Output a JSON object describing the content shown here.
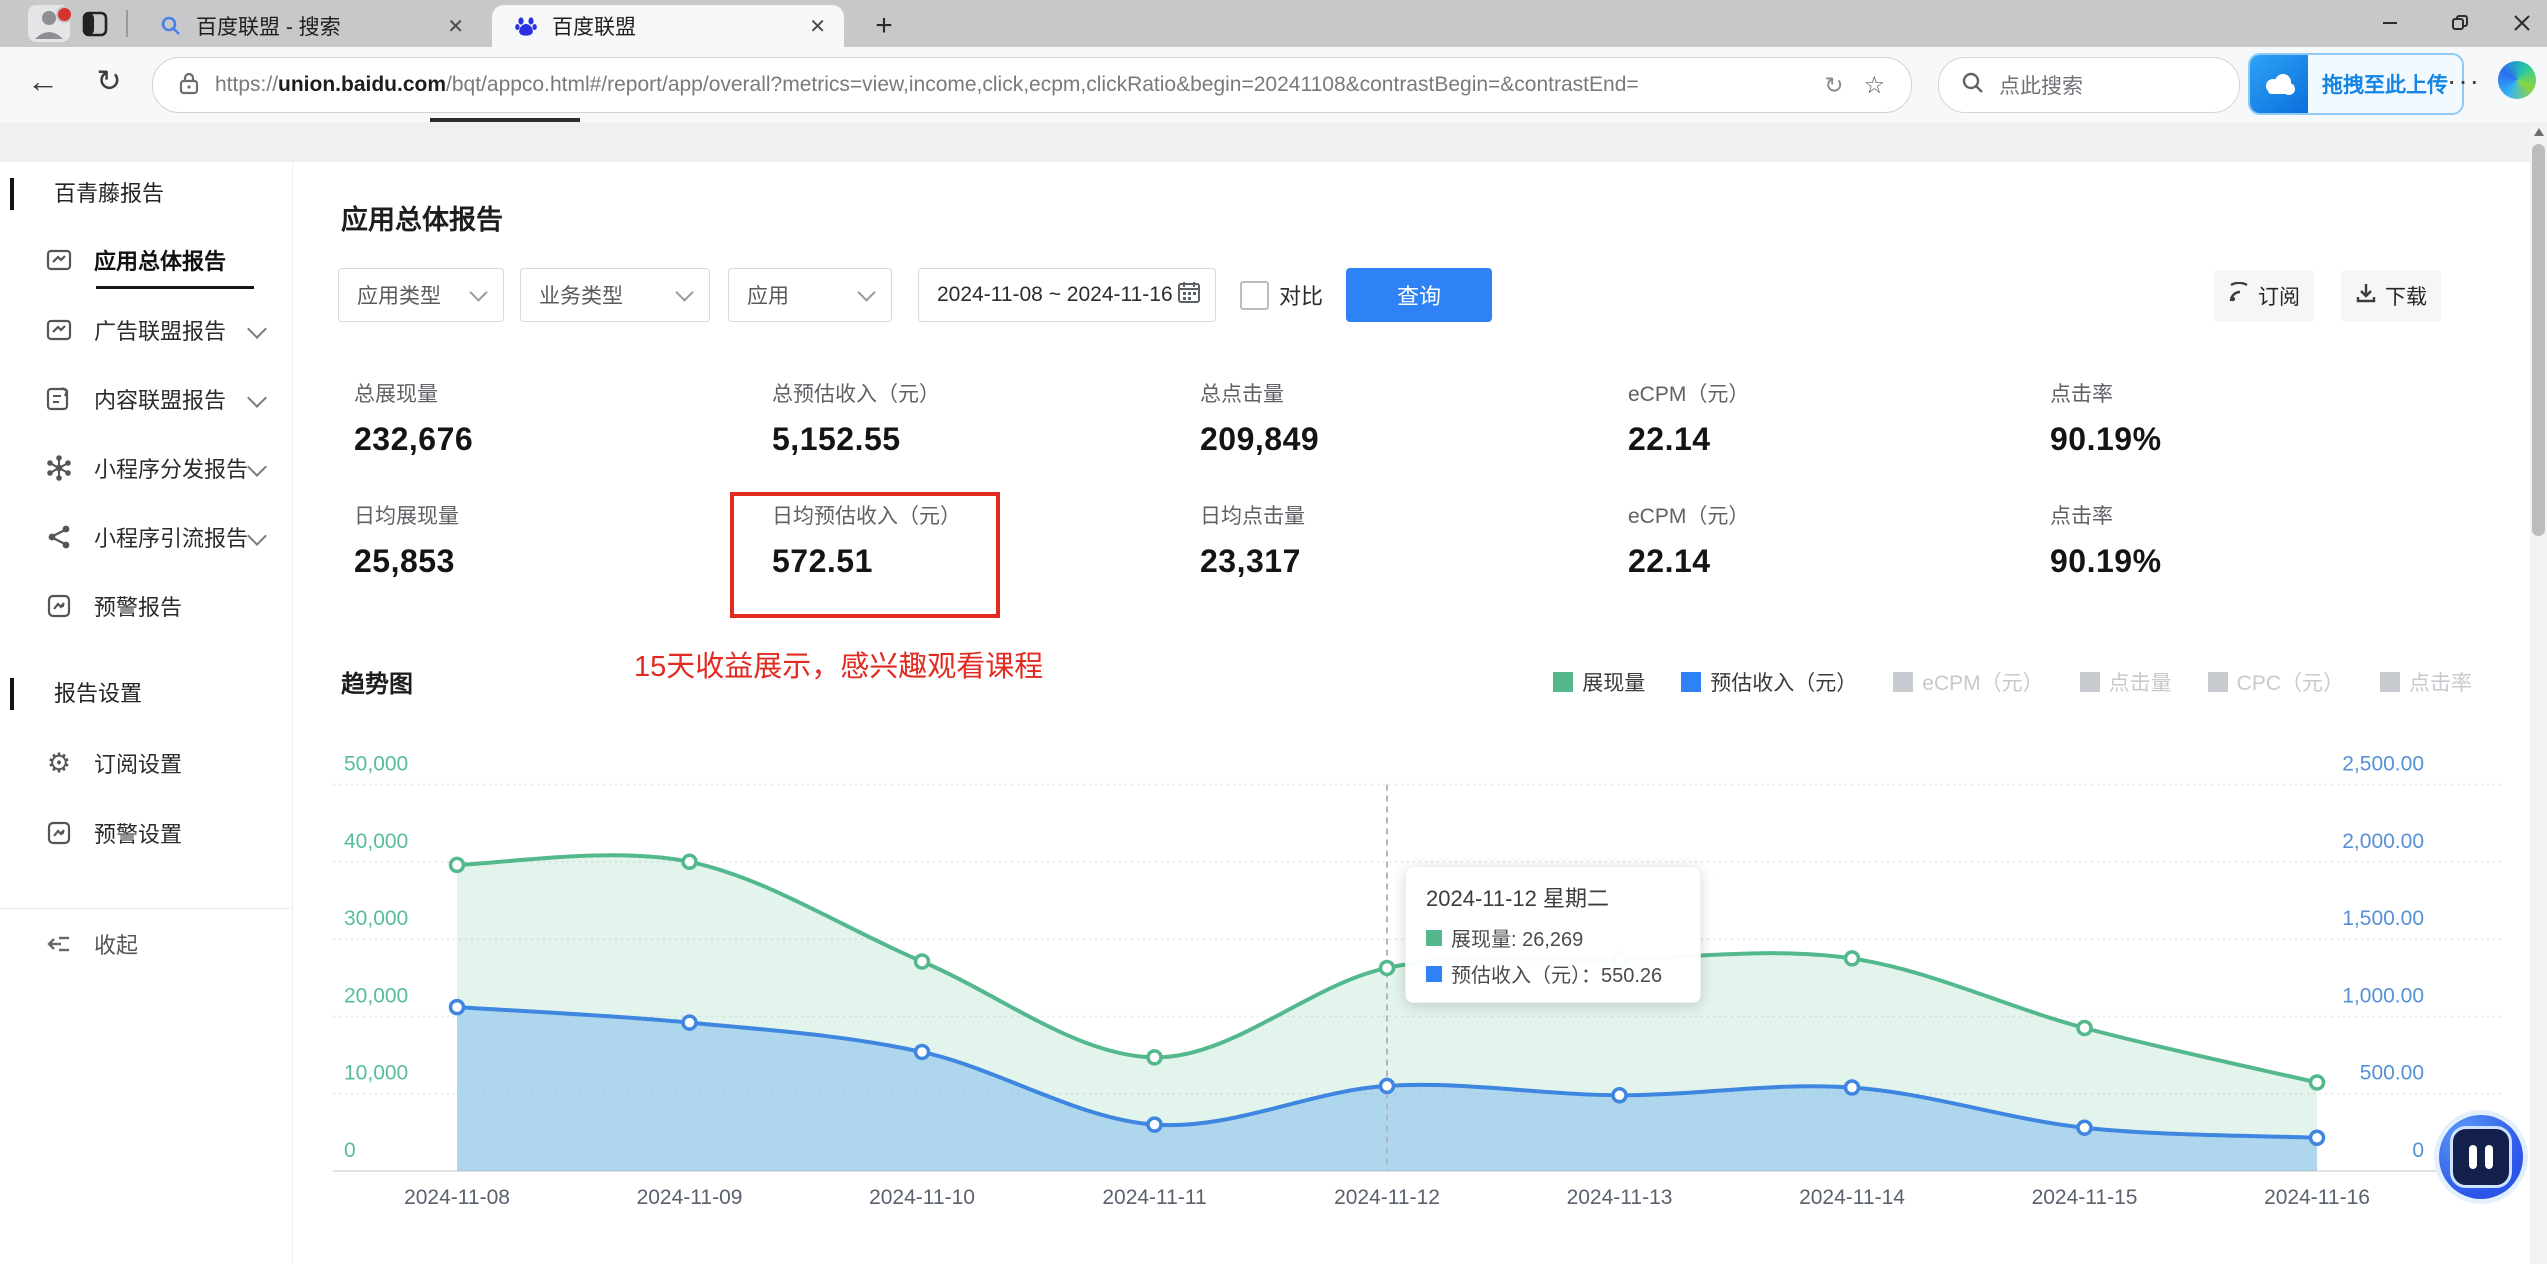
{
  "browser": {
    "tabs": [
      {
        "title": "百度联盟 - 搜索"
      },
      {
        "title": "百度联盟"
      }
    ],
    "url": {
      "scheme": "https://",
      "domain": "union.baidu.com",
      "path": "/bqt/appco.html#/report/app/overall?metrics=view,income,click,ecpm,clickRatio&begin=20241108&contrastBegin=&contrastEnd="
    },
    "search_placeholder": "点此搜索",
    "upload_label": "拖拽至此上传"
  },
  "icons": {
    "back": "←",
    "refresh": "↻",
    "reload_small": "↻",
    "star": "☆",
    "more": "···",
    "new_tab": "+",
    "close_tab": "✕",
    "gear": "⚙"
  },
  "sidebar": {
    "section1": "百青藤报告",
    "items": [
      {
        "label": "应用总体报告",
        "active": true
      },
      {
        "label": "广告联盟报告",
        "chevron": true
      },
      {
        "label": "内容联盟报告",
        "chevron": true
      },
      {
        "label": "小程序分发报告",
        "chevron": true
      },
      {
        "label": "小程序引流报告",
        "chevron": true
      },
      {
        "label": "预警报告"
      }
    ],
    "section2": "报告设置",
    "settings_items": [
      {
        "label": "订阅设置"
      },
      {
        "label": "预警设置"
      }
    ],
    "collapse": "收起"
  },
  "main": {
    "title": "应用总体报告",
    "filters": {
      "app_type": "应用类型",
      "biz_type": "业务类型",
      "app": "应用",
      "date_range": "2024-11-08 ~ 2024-11-16",
      "compare": "对比",
      "query": "查询"
    },
    "actions": {
      "subscribe": "订阅",
      "download": "下载"
    },
    "stats": {
      "rows": [
        {
          "cells": [
            {
              "label": "总展现量",
              "value": "232,676"
            },
            {
              "label": "总预估收入（元）",
              "value": "5,152.55"
            },
            {
              "label": "总点击量",
              "value": "209,849"
            },
            {
              "label": "eCPM（元）",
              "value": "22.14"
            },
            {
              "label": "点击率",
              "value": "90.19%"
            }
          ]
        },
        {
          "cells": [
            {
              "label": "日均展现量",
              "value": "25,853"
            },
            {
              "label": "日均预估收入（元）",
              "value": "572.51"
            },
            {
              "label": "日均点击量",
              "value": "23,317"
            },
            {
              "label": "eCPM（元）",
              "value": "22.14"
            },
            {
              "label": "点击率",
              "value": "90.19%"
            }
          ]
        }
      ]
    },
    "annotation": "15天收益展示，感兴趣观看课程",
    "legend": [
      {
        "label": "展现量",
        "color": "#53b98d",
        "active": true
      },
      {
        "label": "预估收入（元）",
        "color": "#2f82f5",
        "active": true
      },
      {
        "label": "eCPM（元）",
        "color": "#c8cbd0",
        "active": false
      },
      {
        "label": "点击量",
        "color": "#c8cbd0",
        "active": false
      },
      {
        "label": "CPC（元）",
        "color": "#c8cbd0",
        "active": false
      },
      {
        "label": "点击率",
        "color": "#c8cbd0",
        "active": false
      }
    ],
    "tooltip": {
      "title": "2024-11-12 星期二",
      "rows": [
        {
          "color": "#53b98d",
          "text": "展现量: 26,269"
        },
        {
          "color": "#2f82f5",
          "text": "预估收入（元）：550.26"
        }
      ]
    }
  },
  "chart_data": {
    "type": "area",
    "title": "趋势图",
    "x": [
      "2024-11-08",
      "2024-11-09",
      "2024-11-10",
      "2024-11-11",
      "2024-11-12",
      "2024-11-13",
      "2024-11-14",
      "2024-11-15",
      "2024-11-16"
    ],
    "series": [
      {
        "name": "展现量",
        "axis": "left",
        "color": "#53b98d",
        "fill": "rgba(83,185,141,0.16)",
        "values": [
          39600,
          40000,
          27100,
          14700,
          26269,
          27400,
          27500,
          18500,
          11450
        ]
      },
      {
        "name": "预估收入（元）",
        "axis": "right",
        "color": "#3e86e0",
        "fill": "rgba(132,189,235,0.55)",
        "values": [
          1060,
          960,
          770,
          300,
          550.26,
          490,
          540,
          280,
          215
        ]
      }
    ],
    "left_axis": {
      "max": 50000,
      "ticks": [
        "0",
        "10,000",
        "20,000",
        "30,000",
        "40,000",
        "50,000"
      ]
    },
    "right_axis": {
      "max": 2500,
      "ticks": [
        "0",
        "500.00",
        "1,000.00",
        "1,500.00",
        "2,000.00",
        "2,500.00"
      ]
    },
    "highlight": {
      "index": 4,
      "date": "2024-11-12"
    },
    "legend_position": "top-right",
    "grid": true
  }
}
